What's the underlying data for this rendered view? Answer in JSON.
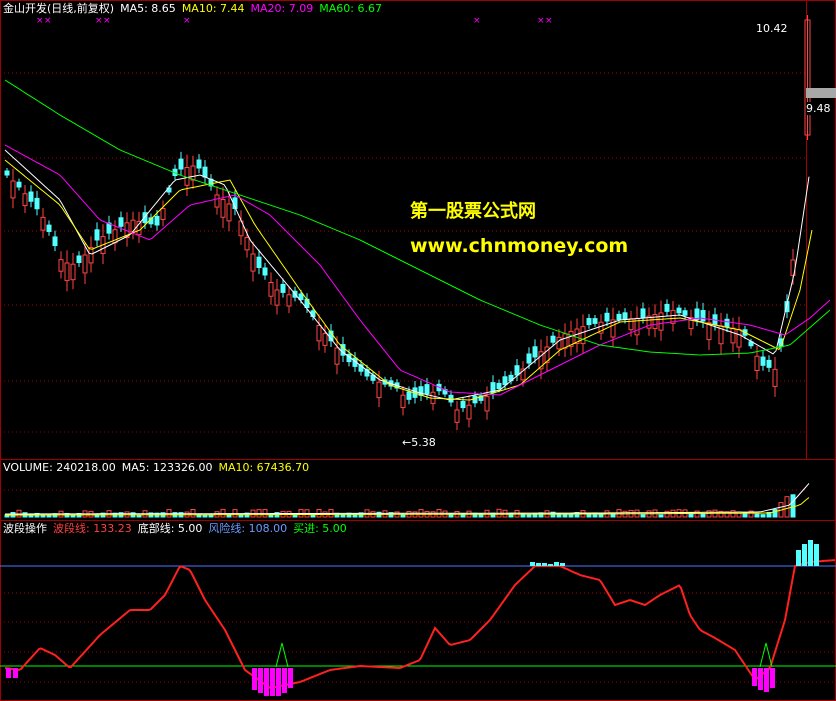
{
  "header": {
    "title": "金山开发(日线,前复权)",
    "ma5": "MA5: 8.65",
    "ma10": "MA10: 7.44",
    "ma20": "MA20: 7.09",
    "ma60": "MA60: 6.67"
  },
  "price_panel": {
    "high_label": "10.42",
    "low_label": "←5.38",
    "current_price": "9.48"
  },
  "watermark": {
    "line1": "第一股票公式网",
    "line2": "www.chnmoney.com"
  },
  "volume_header": {
    "volume": "VOLUME: 240218.00",
    "ma5": "MA5: 123326.00",
    "ma10": "MA10: 67436.70"
  },
  "indicator_header": {
    "title": "波段操作",
    "band_line": "波段线: 133.23",
    "bottom_line": "底部线: 5.00",
    "risk_line": "风险线: 108.00",
    "buy": "买进: 5.00"
  },
  "colors": {
    "background": "#000000",
    "frame": "#a00000",
    "grid": "#a00000",
    "up": "#ff4444",
    "down": "#54ffff",
    "ma5": "#ffffff",
    "ma10": "#ffff00",
    "ma20": "#ff00ff",
    "ma60": "#00ff00",
    "band": "#ff2020",
    "risk": "#4a7aff",
    "bottom": "#00ff00",
    "bar_low": "#ff00ff"
  }
}
